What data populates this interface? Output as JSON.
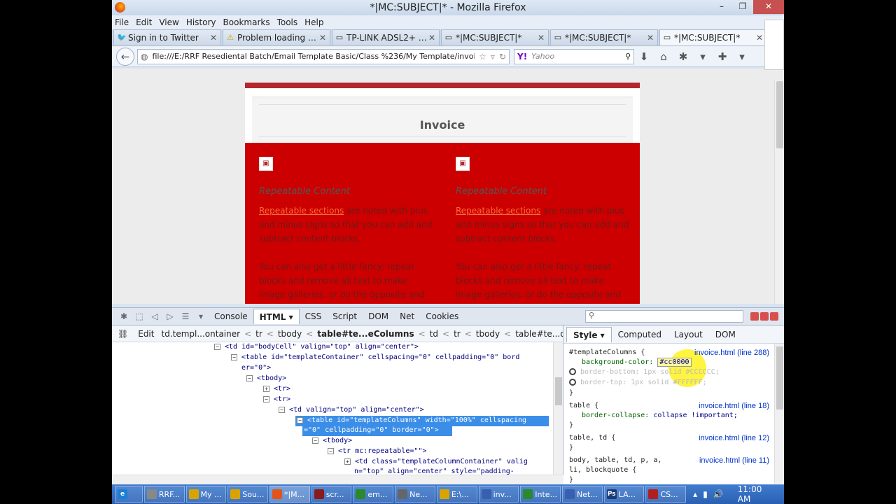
{
  "window": {
    "title": "*|MC:SUBJECT|* - Mozilla Firefox",
    "controls": [
      "–",
      "❐",
      "✕"
    ]
  },
  "menu": [
    "File",
    "Edit",
    "View",
    "History",
    "Bookmarks",
    "Tools",
    "Help"
  ],
  "tabs": [
    {
      "label": "Sign in to Twitter",
      "icon": "twitter-icon"
    },
    {
      "label": "Problem loading page",
      "icon": "warning-icon"
    },
    {
      "label": "TP-LINK ADSL2+ Mo...",
      "icon": "page-icon"
    },
    {
      "label": "*|MC:SUBJECT|*",
      "icon": "page-icon"
    },
    {
      "label": "*|MC:SUBJECT|*",
      "icon": "page-icon"
    },
    {
      "label": "*|MC:SUBJECT|*",
      "icon": "page-icon"
    }
  ],
  "nav": {
    "url": "file:///E:/RRF Resediental Batch/Email Template Basic/Class %236/My Template/invoice.htm",
    "search_placeholder": "Yahoo",
    "search_engine": "Y!"
  },
  "email": {
    "header_title": "Invoice",
    "columns": [
      {
        "heading": "Repeatable Content",
        "link": "Repeatable sections",
        "text1": " are noted with plus and minus signs so that you can add and subtract content blocks.",
        "text2": "You can also get a little fancy: repeat blocks and remove all text to make image galleries, or do the opposite and remove"
      },
      {
        "heading": "Repeatable Content",
        "link": "Repeatable sections",
        "text1": " are noted with plus and minus signs so that you can add and subtract content blocks.",
        "text2": "You can also get a little fancy: repeat blocks and remove all text to make image galleries, or do the opposite and remove"
      }
    ]
  },
  "firebug": {
    "tabs": [
      "Console",
      "HTML ▾",
      "CSS",
      "Script",
      "DOM",
      "Net",
      "Cookies"
    ],
    "active_tab": "HTML ▾",
    "edit_label": "Edit",
    "breadcrumbs": [
      "td.templ...ontainer",
      "tr",
      "tbody",
      "table#te...eColumns",
      "td",
      "tr",
      "tbody",
      "table#te...ontainer"
    ],
    "tree": [
      {
        "text": "<td id=\"bodyCell\" valign=\"top\" align=\"center\">",
        "tog": "⊟"
      },
      {
        "text": "<table id=\"templateContainer\" cellspacing=\"0\" cellpadding=\"0\" bord",
        "tog": "⊟"
      },
      {
        "text": "er=\"0\">",
        "tog": ""
      },
      {
        "text": "<tbody>",
        "tog": "⊟"
      },
      {
        "text": "<tr>",
        "tog": "⊞"
      },
      {
        "text": "<tr>",
        "tog": "⊟"
      },
      {
        "text": "<td valign=\"top\" align=\"center\">",
        "tog": "⊟"
      },
      {
        "text": "<table id=\"templateColumns\" width=\"100%\" cellspacing",
        "tog": "⊟"
      },
      {
        "text": "=\"0\" cellpadding=\"0\" border=\"0\">",
        "tog": ""
      },
      {
        "text": "<tbody>",
        "tog": "⊟"
      },
      {
        "text": "<tr mc:repeatable=\"\">",
        "tog": "⊟"
      },
      {
        "text": "<td class=\"templateColumnContainer\" valig",
        "tog": "⊞"
      },
      {
        "text": "n=\"top\" align=\"center\" style=\"padding-",
        "tog": ""
      }
    ],
    "side_tabs": [
      "Style ▾",
      "Computed",
      "Layout",
      "DOM"
    ],
    "rules": {
      "r1_selector": "#templateColumns {",
      "r1_src": "invoice.html (line 288)",
      "r1_prop": "background-color:",
      "r1_val": "#cc0000",
      "r1_dis1": "border-bottom: 1px solid #CCCCCC;",
      "r1_dis2": "border-top: 1px solid #FFFFFF;",
      "close": "}",
      "r2_selector": "table {",
      "r2_src": "invoice.html (line 18)",
      "r2_prop": "border-collapse:",
      "r2_val": "collapse !important;",
      "r3_selector": "table, td {",
      "r3_src": "invoice.html (line 12)",
      "r4_selector": "body, table, td, p, a,",
      "r4_selector2": "li, blockquote {",
      "r4_src": "invoice.html (line 11)"
    }
  },
  "taskbar": {
    "items": [
      {
        "label": "RRF...",
        "color": "#888888"
      },
      {
        "label": "My ...",
        "color": "#d9a400"
      },
      {
        "label": "Sou...",
        "color": "#d9a400"
      },
      {
        "label": "*|M...",
        "color": "#e1541b"
      },
      {
        "label": "scr...",
        "color": "#8b1a1a"
      },
      {
        "label": "em...",
        "color": "#2a8a2a"
      },
      {
        "label": "Ne...",
        "color": "#666666"
      },
      {
        "label": "E:\\...",
        "color": "#d9a400"
      },
      {
        "label": "inv...",
        "color": "#3a5fb0"
      },
      {
        "label": "Inte...",
        "color": "#2a8a2a"
      },
      {
        "label": "Net...",
        "color": "#3a5fb0"
      },
      {
        "label": "LA...",
        "color": "#1a3a7a"
      },
      {
        "label": "CS...",
        "color": "#b31e1e"
      }
    ],
    "clock": "11:00 AM"
  }
}
